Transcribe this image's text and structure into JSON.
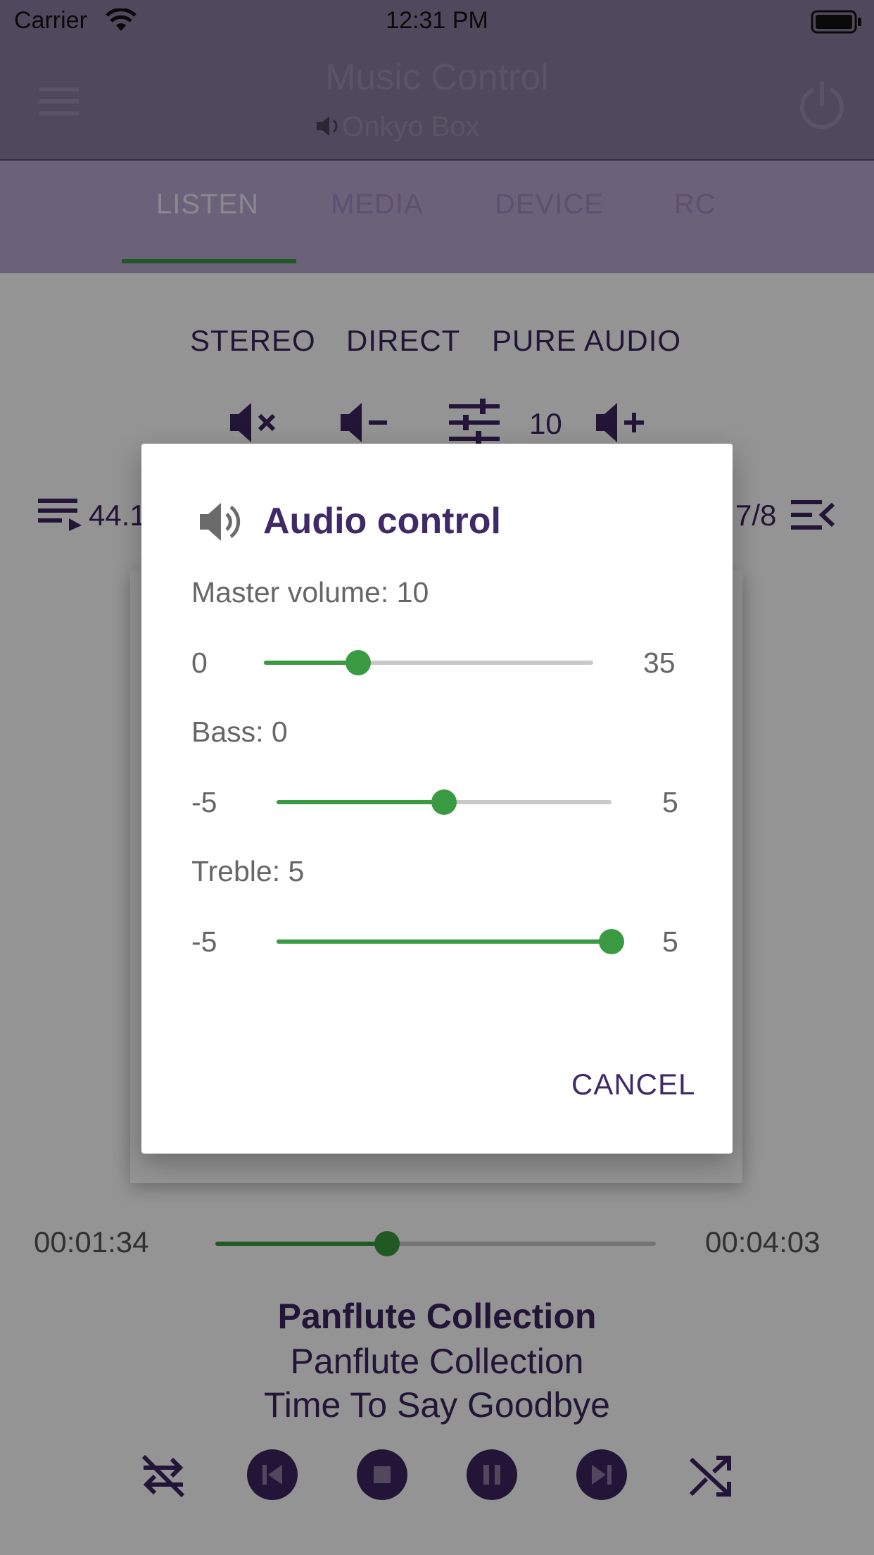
{
  "status_bar": {
    "carrier": "Carrier",
    "time": "12:31 PM"
  },
  "app_bar": {
    "title": "Music Control",
    "device_name": "Onkyo Box",
    "menu_icon": "hamburger-icon",
    "power_icon": "power-icon"
  },
  "tabs": [
    {
      "label": "LISTEN",
      "active": true
    },
    {
      "label": "MEDIA",
      "active": false
    },
    {
      "label": "DEVICE",
      "active": false
    },
    {
      "label": "RC",
      "active": false
    }
  ],
  "listen": {
    "modes": [
      "STEREO",
      "DIRECT",
      "PURE AUDIO"
    ],
    "volume_value": "10",
    "left_info": "44.1",
    "right_info": "7/8",
    "progress": {
      "elapsed": "00:01:34",
      "total": "00:04:03",
      "fraction": 0.39
    },
    "now_playing": {
      "album": "Panflute Collection",
      "artist": "Panflute Collection",
      "track": "Time To Say Goodbye"
    }
  },
  "dialog": {
    "title": "Audio control",
    "master": {
      "label": "Master volume: 10",
      "min": "0",
      "max": "35",
      "value": 10
    },
    "bass": {
      "label": "Bass: 0",
      "min": "-5",
      "max": "5",
      "value": 0
    },
    "treble": {
      "label": "Treble: 5",
      "min": "-5",
      "max": "5",
      "value": 5
    },
    "cancel_label": "CANCEL"
  },
  "colors": {
    "accent_green": "#3a9a41",
    "primary_purple": "#3d255f",
    "title_purple": "#3f2a67"
  }
}
